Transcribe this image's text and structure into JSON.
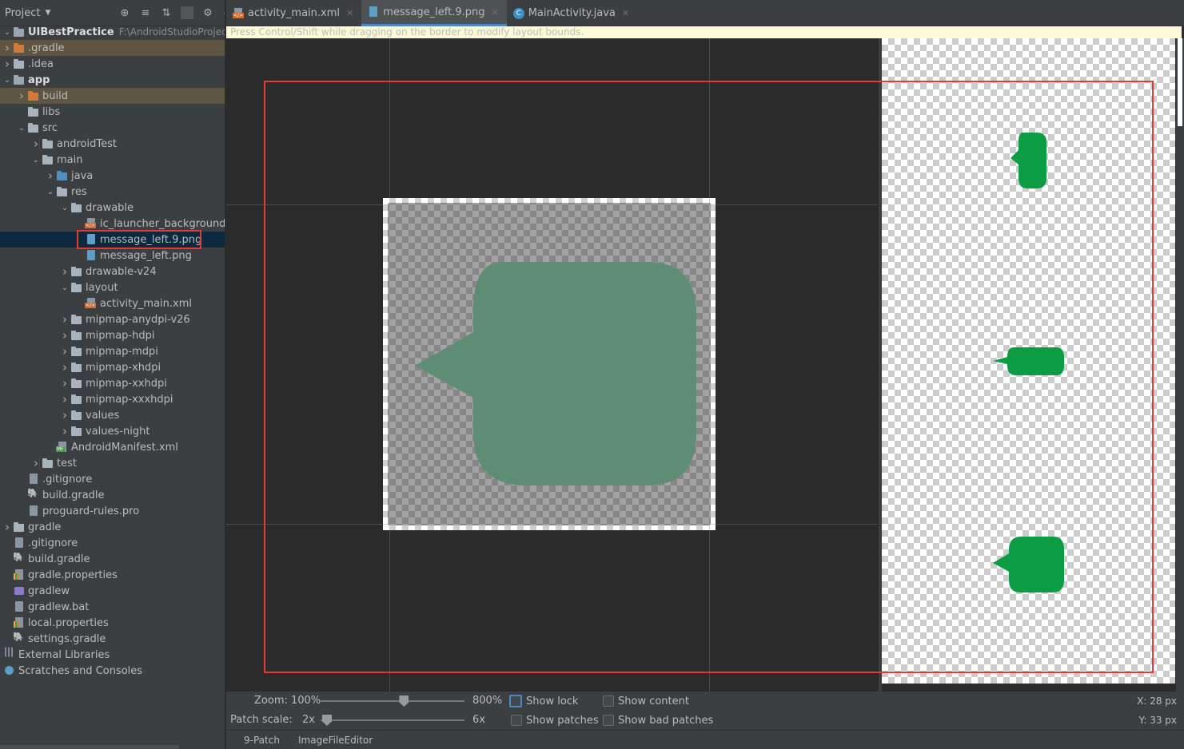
{
  "project_panel": {
    "title": "Project",
    "tools": [
      "globe-icon",
      "collapse-all-icon",
      "expand-icon",
      "gear-icon",
      "minimize-icon"
    ],
    "tree": [
      {
        "label": "UIBestPractice",
        "path": "F:\\AndroidStudioProjects\\UI",
        "depth": 0,
        "arrow": "down",
        "icon": "module",
        "bold": true
      },
      {
        "label": ".gradle",
        "depth": 0,
        "arrow": "right",
        "icon": "folder-orange",
        "style": "build"
      },
      {
        "label": ".idea",
        "depth": 0,
        "arrow": "right",
        "icon": "folder"
      },
      {
        "label": "app",
        "depth": 0,
        "arrow": "down",
        "icon": "module",
        "bold": true
      },
      {
        "label": "build",
        "depth": 1,
        "arrow": "right",
        "icon": "folder-orange",
        "style": "build"
      },
      {
        "label": "libs",
        "depth": 1,
        "arrow": "",
        "icon": "folder"
      },
      {
        "label": "src",
        "depth": 1,
        "arrow": "down",
        "icon": "folder"
      },
      {
        "label": "androidTest",
        "depth": 2,
        "arrow": "right",
        "icon": "folder"
      },
      {
        "label": "main",
        "depth": 2,
        "arrow": "down",
        "icon": "folder"
      },
      {
        "label": "java",
        "depth": 3,
        "arrow": "right",
        "icon": "folder-blue"
      },
      {
        "label": "res",
        "depth": 3,
        "arrow": "down",
        "icon": "folder"
      },
      {
        "label": "drawable",
        "depth": 4,
        "arrow": "down",
        "icon": "folder"
      },
      {
        "label": "ic_launcher_background.xml",
        "depth": 5,
        "arrow": "",
        "icon": "xml"
      },
      {
        "label": "message_left.9.png",
        "depth": 5,
        "arrow": "",
        "icon": "img",
        "style": "selected"
      },
      {
        "label": "message_left.png",
        "depth": 5,
        "arrow": "",
        "icon": "img"
      },
      {
        "label": "drawable-v24",
        "depth": 4,
        "arrow": "right",
        "icon": "folder"
      },
      {
        "label": "layout",
        "depth": 4,
        "arrow": "down",
        "icon": "folder"
      },
      {
        "label": "activity_main.xml",
        "depth": 5,
        "arrow": "",
        "icon": "xml"
      },
      {
        "label": "mipmap-anydpi-v26",
        "depth": 4,
        "arrow": "right",
        "icon": "folder"
      },
      {
        "label": "mipmap-hdpi",
        "depth": 4,
        "arrow": "right",
        "icon": "folder"
      },
      {
        "label": "mipmap-mdpi",
        "depth": 4,
        "arrow": "right",
        "icon": "folder"
      },
      {
        "label": "mipmap-xhdpi",
        "depth": 4,
        "arrow": "right",
        "icon": "folder"
      },
      {
        "label": "mipmap-xxhdpi",
        "depth": 4,
        "arrow": "right",
        "icon": "folder"
      },
      {
        "label": "mipmap-xxxhdpi",
        "depth": 4,
        "arrow": "right",
        "icon": "folder"
      },
      {
        "label": "values",
        "depth": 4,
        "arrow": "right",
        "icon": "folder"
      },
      {
        "label": "values-night",
        "depth": 4,
        "arrow": "right",
        "icon": "folder"
      },
      {
        "label": "AndroidManifest.xml",
        "depth": 3,
        "arrow": "",
        "icon": "manifest"
      },
      {
        "label": "test",
        "depth": 2,
        "arrow": "right",
        "icon": "folder"
      },
      {
        "label": ".gitignore",
        "depth": 1,
        "arrow": "",
        "icon": "file"
      },
      {
        "label": "build.gradle",
        "depth": 1,
        "arrow": "",
        "icon": "gradle"
      },
      {
        "label": "proguard-rules.pro",
        "depth": 1,
        "arrow": "",
        "icon": "file"
      },
      {
        "label": "gradle",
        "depth": 0,
        "arrow": "right",
        "icon": "folder"
      },
      {
        "label": ".gitignore",
        "depth": 0,
        "arrow": "",
        "icon": "file"
      },
      {
        "label": "build.gradle",
        "depth": 0,
        "arrow": "",
        "icon": "gradle"
      },
      {
        "label": "gradle.properties",
        "depth": 0,
        "arrow": "",
        "icon": "props"
      },
      {
        "label": "gradlew",
        "depth": 0,
        "arrow": "",
        "icon": "gradlew"
      },
      {
        "label": "gradlew.bat",
        "depth": 0,
        "arrow": "",
        "icon": "file"
      },
      {
        "label": "local.properties",
        "depth": 0,
        "arrow": "",
        "icon": "props"
      },
      {
        "label": "settings.gradle",
        "depth": 0,
        "arrow": "",
        "icon": "gradle"
      },
      {
        "label": "External Libraries",
        "depth": -1,
        "arrow": "",
        "icon": "libs"
      },
      {
        "label": "Scratches and Consoles",
        "depth": -1,
        "arrow": "",
        "icon": "scratch"
      }
    ]
  },
  "tabs": [
    {
      "label": "activity_main.xml",
      "icon": "xml",
      "active": false
    },
    {
      "label": "message_left.9.png",
      "icon": "img",
      "active": true
    },
    {
      "label": "MainActivity.java",
      "icon": "java",
      "active": false
    }
  ],
  "hint": "Press Control/Shift while dragging on the border to modify layout bounds.",
  "controls": {
    "zoom_label": "Zoom: 100%",
    "zoom_max": "800%",
    "zoom_level": 0.58,
    "patch_scale_label": "Patch scale:",
    "patch_min": "2x",
    "patch_max": "6x",
    "patch_level": 0.0,
    "show_lock": "Show lock",
    "show_patches": "Show patches",
    "show_content": "Show content",
    "show_bad_patches": "Show bad patches",
    "x_coord": "X: 28 px",
    "y_coord": "Y: 33 px"
  },
  "bottom_tabs": [
    "9-Patch",
    "ImageFileEditor"
  ],
  "colors": {
    "bubble_editor": "#5e8c74",
    "bubble_preview": "#0b9c44",
    "highlight": "#e53935",
    "accent": "#4a88c7"
  }
}
